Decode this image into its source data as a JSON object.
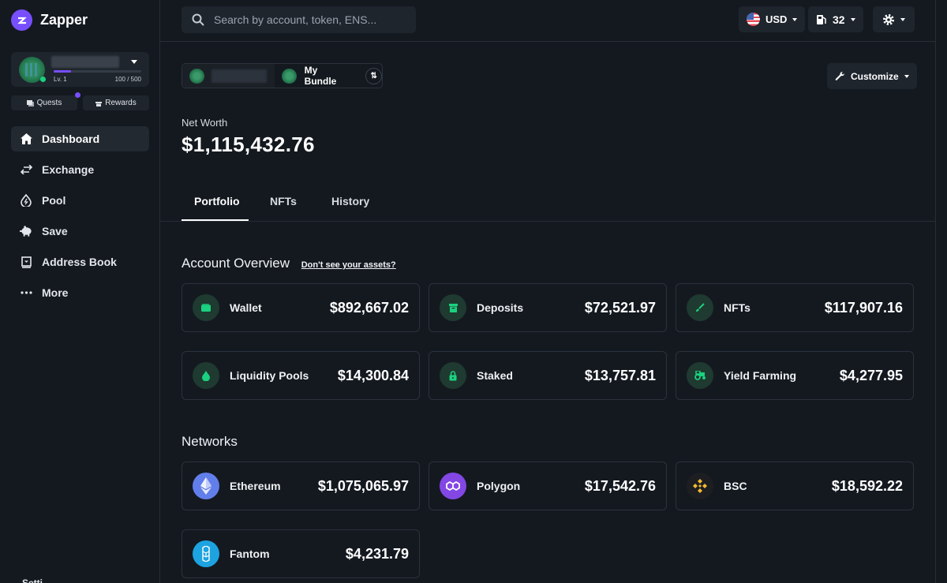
{
  "app": {
    "name": "Zapper"
  },
  "profile": {
    "level": "Lv. 1",
    "xp": "100 / 500",
    "xp_fraction": 0.2
  },
  "quick": {
    "quests": "Quests",
    "rewards": "Rewards"
  },
  "sidebar": {
    "items": [
      {
        "label": "Dashboard",
        "icon": "home-icon",
        "active": true
      },
      {
        "label": "Exchange",
        "icon": "swap-arrows-icon"
      },
      {
        "label": "Pool",
        "icon": "pool-drop-icon"
      },
      {
        "label": "Save",
        "icon": "piggy-bank-icon"
      },
      {
        "label": "Address Book",
        "icon": "address-book-icon"
      },
      {
        "label": "More",
        "icon": "more-dots-icon"
      }
    ],
    "settings_peek": "Setti..."
  },
  "header": {
    "search_placeholder": "Search by account, token, ENS...",
    "currency": "USD",
    "gas": "32"
  },
  "bundle": {
    "label": "My Bundle"
  },
  "customize": "Customize",
  "net_worth": {
    "label": "Net Worth",
    "value": "$1,115,432.76"
  },
  "tabs": [
    "Portfolio",
    "NFTs",
    "History"
  ],
  "account_overview": {
    "title": "Account Overview",
    "link": "Don't see your assets?",
    "cards": [
      {
        "label": "Wallet",
        "value": "$892,667.02",
        "icon": "wallet-icon"
      },
      {
        "label": "Deposits",
        "value": "$72,521.97",
        "icon": "deposit-box-icon"
      },
      {
        "label": "NFTs",
        "value": "$117,907.16",
        "icon": "brush-icon"
      },
      {
        "label": "Liquidity Pools",
        "value": "$14,300.84",
        "icon": "drop-icon"
      },
      {
        "label": "Staked",
        "value": "$13,757.81",
        "icon": "lock-icon"
      },
      {
        "label": "Yield Farming",
        "value": "$4,277.95",
        "icon": "tractor-icon"
      }
    ]
  },
  "networks": {
    "title": "Networks",
    "cards": [
      {
        "label": "Ethereum",
        "value": "$1,075,065.97",
        "icon": "ethereum-icon",
        "color": "#627eea"
      },
      {
        "label": "Polygon",
        "value": "$17,542.76",
        "icon": "polygon-icon",
        "color": "#8247e5"
      },
      {
        "label": "BSC",
        "value": "$18,592.22",
        "icon": "bsc-icon",
        "color": "#f3ba2f"
      },
      {
        "label": "Fantom",
        "value": "$4,231.79",
        "icon": "fantom-icon",
        "color": "#1da3e0"
      }
    ]
  },
  "colors": {
    "accent": "#784ffe",
    "green": "#1ad17f",
    "bg": "#141920",
    "card": "#1f252d"
  }
}
